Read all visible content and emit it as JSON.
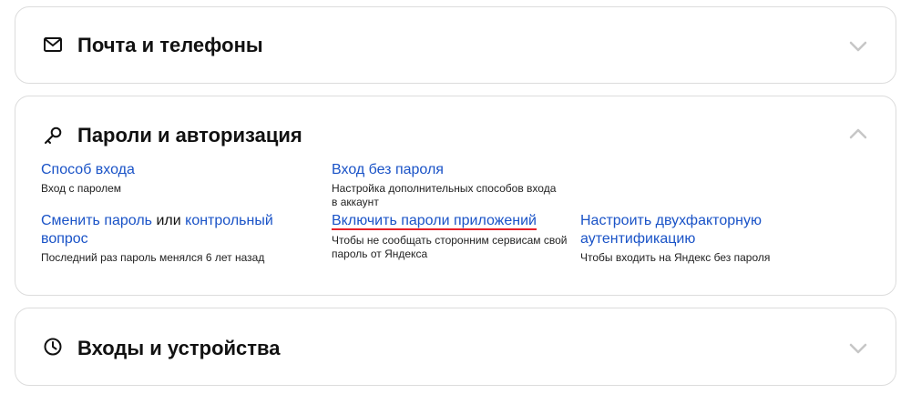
{
  "sections": {
    "mail": {
      "title": "Почта и телефоны",
      "icon": "mail-icon",
      "state": "collapsed"
    },
    "passwords": {
      "title": "Пароли и авторизация",
      "icon": "key-icon",
      "state": "expanded",
      "options": {
        "login_method": {
          "label": "Способ входа",
          "desc": "Вход с паролем"
        },
        "passwordless": {
          "label": "Вход без пароля",
          "desc_line1": "Настройка дополнительных способов входа",
          "desc_line2": "в аккаунт"
        },
        "change_password": {
          "link1": "Сменить пароль",
          "connector": "или",
          "link2_part1": "контрольный",
          "link2_part2": "вопрос",
          "desc": "Последний раз пароль менялся 6 лет назад"
        },
        "app_passwords": {
          "label": "Включить пароли приложений",
          "desc_line1": "Чтобы не сообщать сторонним сервисам свой",
          "desc_line2": "пароль от Яндекса"
        },
        "two_factor": {
          "label_line1": "Настроить двухфакторную",
          "label_line2": "аутентификацию",
          "desc": "Чтобы входить на Яндекс без пароля"
        }
      }
    },
    "logins": {
      "title": "Входы и устройства",
      "icon": "clock-icon",
      "state": "collapsed"
    }
  },
  "colors": {
    "link": "#1a53c7",
    "highlight": "#e8202a",
    "border": "#dcdcdc",
    "chevron": "#c6c6c6"
  }
}
